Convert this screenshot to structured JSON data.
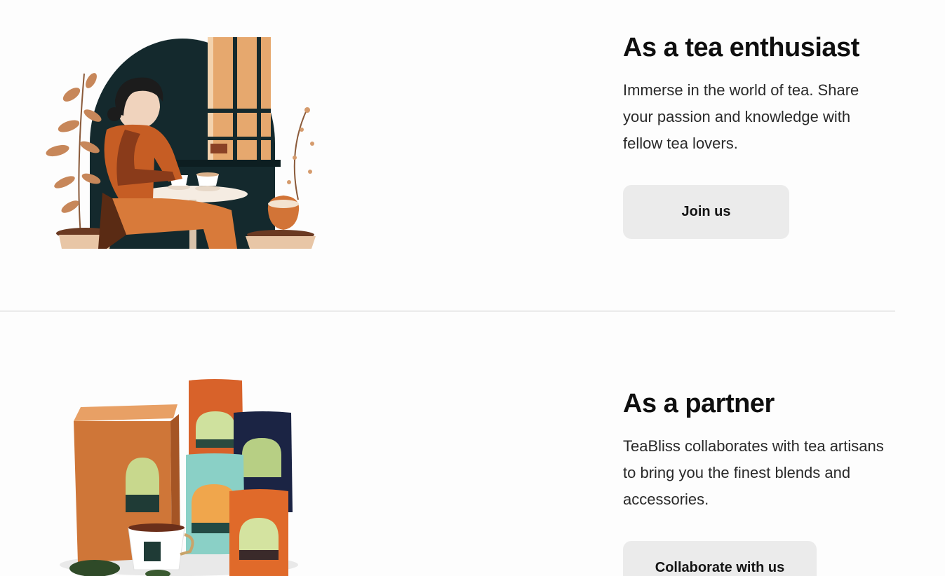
{
  "enthusiast": {
    "title": "As a tea enthusiast",
    "description": "Immerse in the world of tea. Share your passion and knowledge with fellow tea lovers.",
    "button_label": "Join us"
  },
  "partner": {
    "title": "As a partner",
    "description": "TeaBliss collaborates with tea artisans to bring you the finest blends and accessories.",
    "button_label": "Collaborate with us"
  },
  "colors": {
    "button_bg": "#ebebeb",
    "accent_orange": "#d27437",
    "dark_teal": "#14292d"
  }
}
